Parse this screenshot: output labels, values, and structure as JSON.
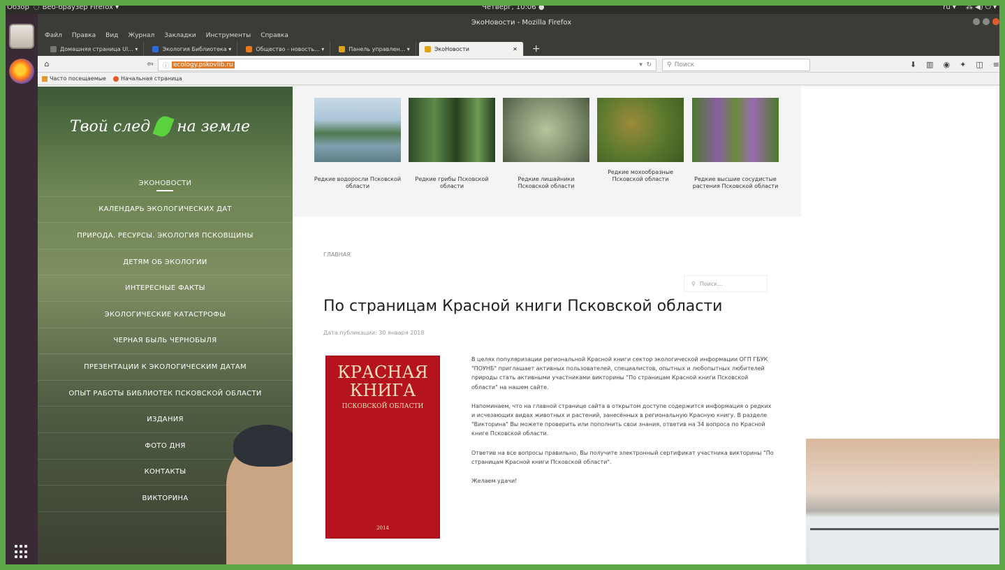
{
  "top_panel": {
    "overview": "Обзор",
    "app": "Веб-браузер Firefox ▾",
    "clock": "Четверг, 10:06 ●",
    "tray": [
      "ru ▾",
      "⁂ ◀) ⏻ ▾"
    ]
  },
  "window": {
    "title": "ЭкоНовости - Mozilla Firefox",
    "menu": [
      "Файл",
      "Правка",
      "Вид",
      "Журнал",
      "Закладки",
      "Инструменты",
      "Справка"
    ],
    "tabs": [
      {
        "label": "Домашняя страница Ul... ▾",
        "color": "#777777"
      },
      {
        "label": "Экология Библиотека ▾",
        "color": "#2d6ad6"
      },
      {
        "label": "Общество - новость... ▾",
        "color": "#e67a21"
      },
      {
        "label": "Панель управлен... ▾",
        "color": "#e0a419"
      },
      {
        "label": "ЭкоНовости",
        "color": "#e0a419",
        "active": true
      }
    ],
    "url": "ecology.pskovlib.ru",
    "search_placeholder": "Поиск"
  },
  "bookmarks": [
    "Часто посещаемые",
    "Начальная страница"
  ],
  "site": {
    "logo_left": "Твой след",
    "logo_right": "на земле",
    "menu": [
      "ЭКОНОВОСТИ",
      "КАЛЕНДАРЬ ЭКОЛОГИЧЕСКИХ ДАТ",
      "ПРИРОДА. РЕСУРСЫ. ЭКОЛОГИЯ ПСКОВЩИНЫ",
      "ДЕТЯМ ОБ ЭКОЛОГИИ",
      "ИНТЕРЕСНЫЕ ФАКТЫ",
      "ЭКОЛОГИЧЕСКИЕ КАТАСТРОФЫ",
      "ЧЕРНАЯ БЫЛЬ ЧЕРНОБЫЛЯ",
      "ПРЕЗЕНТАЦИИ К ЭКОЛОГИЧЕСКИМ ДАТАМ",
      "ОПЫТ РАБОТЫ БИБЛИОТЕК ПСКОВСКОЙ ОБЛАСТИ",
      "ИЗДАНИЯ",
      "ФОТО ДНЯ",
      "КОНТАКТЫ",
      "ВИКТОРИНА"
    ]
  },
  "gallery": [
    {
      "caption": "Редкие водоросли Псковской области",
      "color": "#7aa0b5"
    },
    {
      "caption": "Редкие грибы Псковской области",
      "color": "#3f6a34"
    },
    {
      "caption": "Редкие лишайники Псковской области",
      "color": "#7c8c6b"
    },
    {
      "caption": "Редкие мохообразные Псковской области",
      "color": "#5d7a2e"
    },
    {
      "caption": "Редкие высшие сосудистые растения Псковской области",
      "color": "#6a8a3c"
    }
  ],
  "article": {
    "breadcrumb": "Главная",
    "search_placeholder": "Поиск...",
    "title": "По страницам Красной книги Псковской области",
    "date": "Дата публикации: 30 января 2018",
    "book": {
      "line1": "КРАСНАЯ",
      "line2": "КНИГА",
      "line3": "ПСКОВСКОЙ ОБЛАСТИ",
      "year": "2014"
    },
    "paragraphs": [
      "В целях популяризации региональной Красной книги сектор экологической информации ОГП ГБУК \"ПОУНБ\" приглашает активных пользователей, специалистов, опытных и любопытных любителей природы стать активными участниками викторины \"По страницам Красной книги Псковской области\" на нашем сайте.",
      "Напоминаем, что на главной странице сайта в открытом доступе содержится информация о редких и исчезающих видах животных и растений, занесённых в региональную Красную книгу. В разделе \"Викторина\" Вы можете проверить или пополнить свои знания, ответив на 34 вопроса по Красной книге Псковской области.",
      "Ответив на все вопросы правильно, Вы получите электронный сертификат участника викторины \"По страницам Красной книги Псковской области\".",
      "Желаем удачи!"
    ]
  }
}
